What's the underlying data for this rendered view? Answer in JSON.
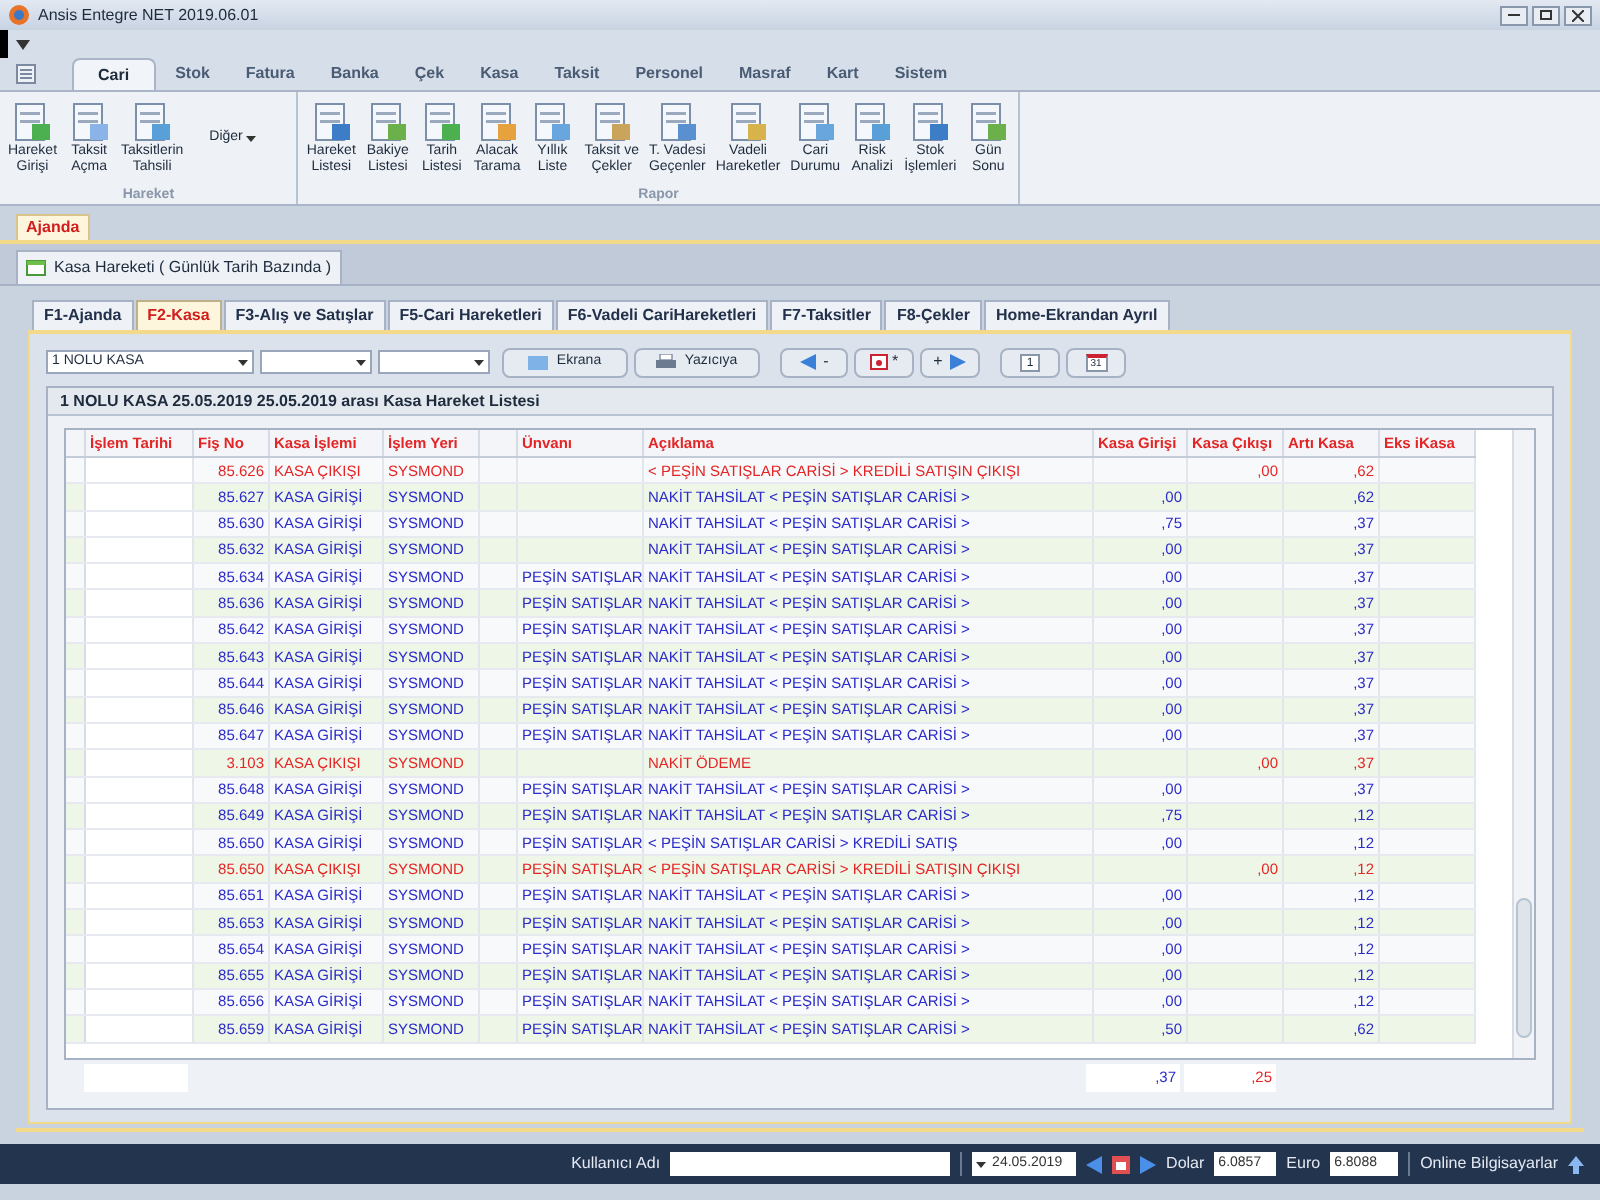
{
  "window": {
    "title": "Ansis Entegre NET 2019.06.01"
  },
  "ribbon": {
    "tabs": [
      {
        "label": "Cari",
        "selected": true
      },
      {
        "label": "Stok",
        "selected": false
      },
      {
        "label": "Fatura",
        "selected": false
      },
      {
        "label": "Banka",
        "selected": false
      },
      {
        "label": "Çek",
        "selected": false
      },
      {
        "label": "Kasa",
        "selected": false
      },
      {
        "label": "Taksit",
        "selected": false
      },
      {
        "label": "Personel",
        "selected": false
      },
      {
        "label": "Masraf",
        "selected": false
      },
      {
        "label": "Kart",
        "selected": false
      },
      {
        "label": "Sistem",
        "selected": false
      }
    ],
    "groups": [
      {
        "title": "Hareket",
        "buttons": [
          {
            "label": "Hareket\nGirişi"
          },
          {
            "label": "Taksit\nAçma"
          },
          {
            "label": "Taksitlerin\nTahsili"
          }
        ],
        "menu": "Diğer"
      },
      {
        "title": "Rapor",
        "buttons": [
          {
            "label": "Hareket\nListesi"
          },
          {
            "label": "Bakiye\nListesi"
          },
          {
            "label": "Tarih\nListesi"
          },
          {
            "label": "Alacak\nTarama"
          },
          {
            "label": "Yıllık\nListe"
          },
          {
            "label": "Taksit ve\nÇekler"
          },
          {
            "label": "T. Vadesi\nGeçenler"
          },
          {
            "label": "Vadeli\nHareketler"
          },
          {
            "label": "Cari\nDurumu"
          },
          {
            "label": "Risk\nAnalizi"
          },
          {
            "label": "Stok\nİşlemleri"
          },
          {
            "label": "Gün\nSonu"
          }
        ]
      }
    ]
  },
  "top_tabs": [
    {
      "label": "Ajanda",
      "selected": true
    }
  ],
  "document_tab": {
    "label": "Kasa Hareketi ( Günlük Tarih Bazında )"
  },
  "page_tabs": [
    {
      "label": "F1-Ajanda",
      "selected": false
    },
    {
      "label": "F2-Kasa",
      "selected": true
    },
    {
      "label": "F3-Alış ve Satışlar",
      "selected": false
    },
    {
      "label": "F5-Cari Hareketleri",
      "selected": false
    },
    {
      "label": "F6-Vadeli CariHareketleri",
      "selected": false
    },
    {
      "label": "F7-Taksitler",
      "selected": false
    },
    {
      "label": "F8-Çekler",
      "selected": false
    },
    {
      "label": "Home-Ekrandan Ayrıl",
      "selected": false
    }
  ],
  "toolbar": {
    "kasa_select": {
      "value": "1 NOLU KASA"
    },
    "screen_button": "Ekrana",
    "print_button": "Yazıcıya",
    "prev_button": "-",
    "today_button": "*",
    "next_button": "+",
    "day_button": "1",
    "month_button": "31"
  },
  "list_title": "1 NOLU KASA 25.05.2019 25.05.2019 arası Kasa Hareket Listesi",
  "table": {
    "columns": [
      "İşlem Tarihi",
      "Fiş No",
      "Kasa İşlemi",
      "İşlem Yeri",
      "",
      "Ünvanı",
      "Açıklama",
      "Kasa Girişi",
      "Kasa Çıkışı",
      "Artı Kasa",
      "Eks iKasa"
    ],
    "rows": [
      {
        "kind": "cikis",
        "fis_no": "85.626",
        "kasa_islemi": "KASA ÇIKIŞI",
        "islem_yeri": "SYSMOND",
        "aciklama": "< PEŞİN SATIŞLAR CARİSİ > KREDİLİ SATIŞIN ÇIKIŞI",
        "kasa_cikisi": ",00",
        "arti_kasa": ",62"
      },
      {
        "kind": "giris",
        "fis_no": "85.627",
        "kasa_islemi": "KASA GİRİŞİ",
        "islem_yeri": "SYSMOND",
        "aciklama": "NAKİT TAHSİLAT < PEŞİN SATIŞLAR CARİSİ >",
        "kasa_girisi": ",00",
        "arti_kasa": ",62"
      },
      {
        "kind": "giris",
        "fis_no": "85.630",
        "kasa_islemi": "KASA GİRİŞİ",
        "islem_yeri": "SYSMOND",
        "aciklama": "NAKİT TAHSİLAT < PEŞİN SATIŞLAR CARİSİ >",
        "kasa_girisi": ",75",
        "arti_kasa": ",37"
      },
      {
        "kind": "giris",
        "fis_no": "85.632",
        "kasa_islemi": "KASA GİRİŞİ",
        "islem_yeri": "SYSMOND",
        "aciklama": "NAKİT TAHSİLAT < PEŞİN SATIŞLAR CARİSİ >",
        "kasa_girisi": ",00",
        "arti_kasa": ",37"
      },
      {
        "kind": "giris",
        "fis_no": "85.634",
        "kasa_islemi": "KASA GİRİŞİ",
        "islem_yeri": "SYSMOND",
        "unvan": "PEŞİN SATIŞLAR",
        "aciklama": "NAKİT TAHSİLAT < PEŞİN SATIŞLAR CARİSİ >",
        "kasa_girisi": ",00",
        "arti_kasa": ",37"
      },
      {
        "kind": "giris",
        "fis_no": "85.636",
        "kasa_islemi": "KASA GİRİŞİ",
        "islem_yeri": "SYSMOND",
        "unvan": "PEŞİN SATIŞLAR",
        "aciklama": "NAKİT TAHSİLAT < PEŞİN SATIŞLAR CARİSİ >",
        "kasa_girisi": ",00",
        "arti_kasa": ",37"
      },
      {
        "kind": "giris",
        "fis_no": "85.642",
        "kasa_islemi": "KASA GİRİŞİ",
        "islem_yeri": "SYSMOND",
        "unvan": "PEŞİN SATIŞLAR",
        "aciklama": "NAKİT TAHSİLAT < PEŞİN SATIŞLAR CARİSİ >",
        "kasa_girisi": ",00",
        "arti_kasa": ",37"
      },
      {
        "kind": "giris",
        "fis_no": "85.643",
        "kasa_islemi": "KASA GİRİŞİ",
        "islem_yeri": "SYSMOND",
        "unvan": "PEŞİN SATIŞLAR",
        "aciklama": "NAKİT TAHSİLAT < PEŞİN SATIŞLAR CARİSİ >",
        "kasa_girisi": ",00",
        "arti_kasa": ",37"
      },
      {
        "kind": "giris",
        "fis_no": "85.644",
        "kasa_islemi": "KASA GİRİŞİ",
        "islem_yeri": "SYSMOND",
        "unvan": "PEŞİN SATIŞLAR",
        "aciklama": "NAKİT TAHSİLAT < PEŞİN SATIŞLAR CARİSİ >",
        "kasa_girisi": ",00",
        "arti_kasa": ",37"
      },
      {
        "kind": "giris",
        "fis_no": "85.646",
        "kasa_islemi": "KASA GİRİŞİ",
        "islem_yeri": "SYSMOND",
        "unvan": "PEŞİN SATIŞLAR",
        "aciklama": "NAKİT TAHSİLAT < PEŞİN SATIŞLAR CARİSİ >",
        "kasa_girisi": ",00",
        "arti_kasa": ",37"
      },
      {
        "kind": "giris",
        "fis_no": "85.647",
        "kasa_islemi": "KASA GİRİŞİ",
        "islem_yeri": "SYSMOND",
        "unvan": "PEŞİN SATIŞLAR",
        "aciklama": "NAKİT TAHSİLAT < PEŞİN SATIŞLAR CARİSİ >",
        "kasa_girisi": ",00",
        "arti_kasa": ",37"
      },
      {
        "kind": "cikis",
        "fis_no": "3.103",
        "kasa_islemi": "KASA ÇIKIŞI",
        "islem_yeri": "SYSMOND",
        "aciklama": "NAKİT ÖDEME",
        "kasa_cikisi": ",00",
        "arti_kasa": ",37"
      },
      {
        "kind": "giris",
        "fis_no": "85.648",
        "kasa_islemi": "KASA GİRİŞİ",
        "islem_yeri": "SYSMOND",
        "unvan": "PEŞİN SATIŞLAR",
        "aciklama": "NAKİT TAHSİLAT < PEŞİN SATIŞLAR CARİSİ >",
        "kasa_girisi": ",00",
        "arti_kasa": ",37"
      },
      {
        "kind": "giris",
        "fis_no": "85.649",
        "kasa_islemi": "KASA GİRİŞİ",
        "islem_yeri": "SYSMOND",
        "unvan": "PEŞİN SATIŞLAR",
        "aciklama": "NAKİT TAHSİLAT < PEŞİN SATIŞLAR CARİSİ >",
        "kasa_girisi": ",75",
        "arti_kasa": ",12"
      },
      {
        "kind": "giris",
        "fis_no": "85.650",
        "kasa_islemi": "KASA GİRİŞİ",
        "islem_yeri": "SYSMOND",
        "unvan": "PEŞİN SATIŞLAR",
        "aciklama": "< PEŞİN SATIŞLAR CARİSİ > KREDİLİ SATIŞ",
        "kasa_girisi": ",00",
        "arti_kasa": ",12"
      },
      {
        "kind": "cikis",
        "fis_no": "85.650",
        "kasa_islemi": "KASA ÇIKIŞI",
        "islem_yeri": "SYSMOND",
        "unvan": "PEŞİN SATIŞLAR",
        "aciklama": "< PEŞİN SATIŞLAR CARİSİ > KREDİLİ SATIŞIN ÇIKIŞI",
        "kasa_cikisi": ",00",
        "arti_kasa": ",12"
      },
      {
        "kind": "giris",
        "fis_no": "85.651",
        "kasa_islemi": "KASA GİRİŞİ",
        "islem_yeri": "SYSMOND",
        "unvan": "PEŞİN SATIŞLAR",
        "aciklama": "NAKİT TAHSİLAT < PEŞİN SATIŞLAR CARİSİ >",
        "kasa_girisi": ",00",
        "arti_kasa": ",12"
      },
      {
        "kind": "giris",
        "fis_no": "85.653",
        "kasa_islemi": "KASA GİRİŞİ",
        "islem_yeri": "SYSMOND",
        "unvan": "PEŞİN SATIŞLAR",
        "aciklama": "NAKİT TAHSİLAT < PEŞİN SATIŞLAR CARİSİ >",
        "kasa_girisi": ",00",
        "arti_kasa": ",12"
      },
      {
        "kind": "giris",
        "fis_no": "85.654",
        "kasa_islemi": "KASA GİRİŞİ",
        "islem_yeri": "SYSMOND",
        "unvan": "PEŞİN SATIŞLAR",
        "aciklama": "NAKİT TAHSİLAT < PEŞİN SATIŞLAR CARİSİ >",
        "kasa_girisi": ",00",
        "arti_kasa": ",12"
      },
      {
        "kind": "giris",
        "fis_no": "85.655",
        "kasa_islemi": "KASA GİRİŞİ",
        "islem_yeri": "SYSMOND",
        "unvan": "PEŞİN SATIŞLAR",
        "aciklama": "NAKİT TAHSİLAT < PEŞİN SATIŞLAR CARİSİ >",
        "kasa_girisi": ",00",
        "arti_kasa": ",12"
      },
      {
        "kind": "giris",
        "fis_no": "85.656",
        "kasa_islemi": "KASA GİRİŞİ",
        "islem_yeri": "SYSMOND",
        "unvan": "PEŞİN SATIŞLAR",
        "aciklama": "NAKİT TAHSİLAT < PEŞİN SATIŞLAR CARİSİ >",
        "kasa_girisi": ",00",
        "arti_kasa": ",12"
      },
      {
        "kind": "giris",
        "fis_no": "85.659",
        "kasa_islemi": "KASA GİRİŞİ",
        "islem_yeri": "SYSMOND",
        "unvan": "PEŞİN SATIŞLAR",
        "aciklama": "NAKİT TAHSİLAT < PEŞİN SATIŞLAR CARİSİ >",
        "kasa_girisi": ",50",
        "arti_kasa": ",62"
      }
    ],
    "totals": {
      "kasa_girisi": ",37",
      "kasa_cikisi": ",25"
    }
  },
  "status_bar": {
    "user_label": "Kullanıcı Adı",
    "date": "24.05.2019",
    "dollar_label": "Dolar",
    "dollar": "6.0857",
    "euro_label": "Euro",
    "euro": "6.8088",
    "online": "Online Bilgisayarlar"
  }
}
